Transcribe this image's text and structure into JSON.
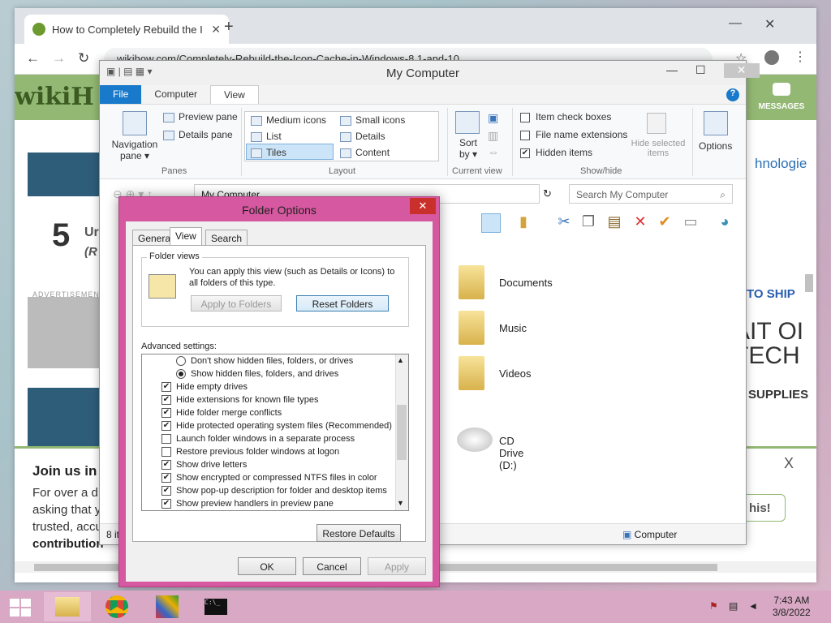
{
  "browser": {
    "tab_title": "How to Completely Rebuild the I",
    "new_tab": "+",
    "url": "wikihow.com/Completely-Rebuild-the-Icon-Cache-in-Windows-8.1-and-10",
    "back": "←",
    "forward": "→",
    "reload": "↻"
  },
  "wikihow": {
    "logo": "wikiH",
    "messages": "MESSAGES",
    "step_number": "5",
    "step_title": "Ur",
    "step_sub": "(R",
    "advertisement": "ADVERTISEMEN",
    "tech": "hnologie",
    "ad1": "TO SHIP",
    "ad2a": "AIT OI",
    "ad2b": "TECH",
    "ad3": "SUPPLIES",
    "join_title": "Join us in",
    "join_l1": "For over a d",
    "join_l2": "asking that y",
    "join_l3": "trusted, accu",
    "join_l4": "contribution",
    "close_x": "X",
    "this_btn": "his!"
  },
  "explorer": {
    "title": "My Computer",
    "tabs": [
      "File",
      "Computer",
      "View"
    ],
    "help": "?",
    "nav_pane": "Navigation pane ▾",
    "preview_pane": "Preview pane",
    "details_pane": "Details pane",
    "grp_panes": "Panes",
    "layout": [
      "Medium icons",
      "Small icons",
      "List",
      "Details",
      "Tiles",
      "Content"
    ],
    "grp_layout": "Layout",
    "sort_by": "Sort by ▾",
    "grp_current": "Current view",
    "item_check": "Item check boxes",
    "file_ext": "File name extensions",
    "hidden_items": "Hidden items",
    "hide_selected": "Hide selected items",
    "grp_showhide": "Show/hide",
    "options": "Options",
    "address": "My Computer",
    "search_placeholder": "Search My Computer",
    "files": [
      "Documents",
      "Music",
      "Videos",
      "CD Drive (D:)"
    ],
    "status_left": "8 it",
    "status_right": "Computer"
  },
  "dialog": {
    "title": "Folder Options",
    "close": "✕",
    "tabs": [
      "General",
      "View",
      "Search"
    ],
    "folder_views": "Folder views",
    "fv_text": "You can apply this view (such as Details or Icons) to all folders of this type.",
    "apply_folders": "Apply to Folders",
    "reset_folders": "Reset Folders",
    "advanced": "Advanced settings:",
    "items": [
      {
        "label": "Don't show hidden files, folders, or drives",
        "type": "radio",
        "checked": false
      },
      {
        "label": "Show hidden files, folders, and drives",
        "type": "radio",
        "checked": true
      },
      {
        "label": "Hide empty drives",
        "type": "check",
        "checked": true
      },
      {
        "label": "Hide extensions for known file types",
        "type": "check",
        "checked": true
      },
      {
        "label": "Hide folder merge conflicts",
        "type": "check",
        "checked": true
      },
      {
        "label": "Hide protected operating system files (Recommended)",
        "type": "check",
        "checked": true
      },
      {
        "label": "Launch folder windows in a separate process",
        "type": "check",
        "checked": false
      },
      {
        "label": "Restore previous folder windows at logon",
        "type": "check",
        "checked": false
      },
      {
        "label": "Show drive letters",
        "type": "check",
        "checked": true
      },
      {
        "label": "Show encrypted or compressed NTFS files in color",
        "type": "check",
        "checked": true
      },
      {
        "label": "Show pop-up description for folder and desktop items",
        "type": "check",
        "checked": true
      },
      {
        "label": "Show preview handlers in preview pane",
        "type": "check",
        "checked": true
      }
    ],
    "restore_defaults": "Restore Defaults",
    "ok": "OK",
    "cancel": "Cancel",
    "apply": "Apply"
  },
  "taskbar": {
    "time": "7:43 AM",
    "date": "3/8/2022"
  },
  "colors": {
    "dialog_frame": "#d658a0",
    "accent": "#1979ca",
    "wikihow_green": "#93b874"
  }
}
